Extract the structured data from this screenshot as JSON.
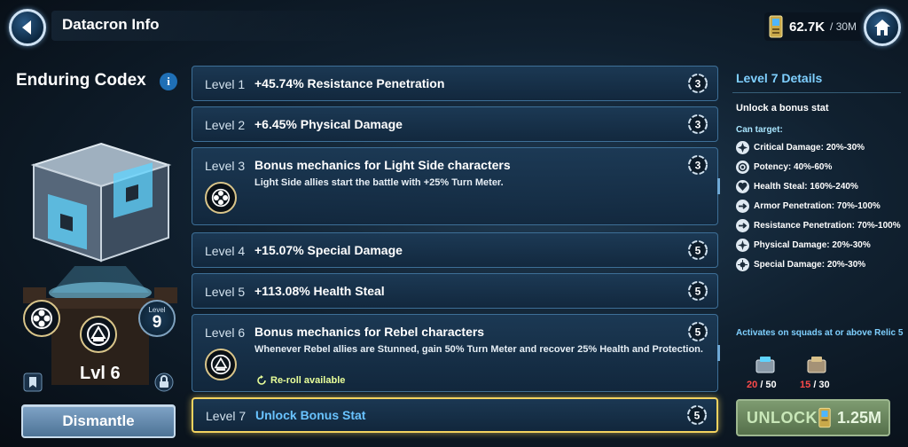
{
  "header": {
    "title": "Datacron Info",
    "currency_amount": "62.7K",
    "currency_cap": "/ 30M"
  },
  "datacron": {
    "name": "Enduring Codex",
    "info_glyph": "i",
    "level_badge_label": "Level",
    "level_badge_value": "9",
    "lvl_text": "Lvl 6",
    "dismantle_label": "Dismantle"
  },
  "levels": [
    {
      "level": "Level 1",
      "bonus": "+45.74% Resistance Penetration",
      "cost": "3"
    },
    {
      "level": "Level 2",
      "bonus": "+6.45% Physical Damage",
      "cost": "3"
    },
    {
      "level": "Level 3",
      "bonus": "Bonus mechanics for Light Side characters",
      "desc": "Light Side allies start the battle with +25% Turn Meter.",
      "cost": "3"
    },
    {
      "level": "Level 4",
      "bonus": "+15.07% Special Damage",
      "cost": "5"
    },
    {
      "level": "Level 5",
      "bonus": "+113.08% Health Steal",
      "cost": "5"
    },
    {
      "level": "Level 6",
      "bonus": "Bonus mechanics for Rebel characters",
      "desc": "Whenever Rebel allies are Stunned, gain 50% Turn Meter and recover 25% Health and Protection.",
      "reroll": "Re-roll available",
      "cost": "5"
    },
    {
      "level": "Level 7",
      "bonus": "Unlock Bonus Stat",
      "cost": "5"
    }
  ],
  "details": {
    "title": "Level 7 Details",
    "subtitle": "Unlock a bonus stat",
    "can_target": "Can target:",
    "stats": [
      {
        "icon": "critical-damage-icon",
        "text": "Critical Damage: 20%-30%"
      },
      {
        "icon": "potency-icon",
        "text": "Potency: 40%-60%"
      },
      {
        "icon": "health-steal-icon",
        "text": "Health Steal: 160%-240%"
      },
      {
        "icon": "armor-penetration-icon",
        "text": "Armor Penetration: 70%-100%"
      },
      {
        "icon": "resistance-penetration-icon",
        "text": "Resistance Penetration: 70%-100%"
      },
      {
        "icon": "physical-damage-icon",
        "text": "Physical Damage: 20%-30%"
      },
      {
        "icon": "special-damage-icon",
        "text": "Special Damage: 20%-30%"
      }
    ],
    "activates": "Activates on squads at or above Relic 5",
    "materials": [
      {
        "have": "20",
        "need": "/ 50"
      },
      {
        "have": "15",
        "need": "/ 30"
      }
    ],
    "unlock_label": "UNLOCK",
    "unlock_cost": "1.25M"
  },
  "colors": {
    "accent_blue": "#7fd0ff",
    "gold_highlight": "#f3d35f",
    "insufficient_red": "#ff4a4a",
    "unlock_green": "#55704a"
  }
}
